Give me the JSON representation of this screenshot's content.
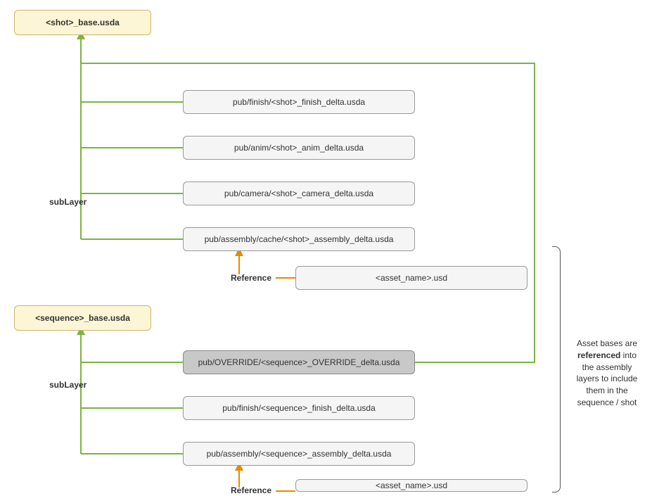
{
  "nodes": {
    "shot_base": "<shot>_base.usda",
    "sequence_base": "<sequence>_base.usda",
    "finish_shot": "pub/finish/<shot>_finish_delta.usda",
    "anim_shot": "pub/anim/<shot>_anim_delta.usda",
    "camera_shot": "pub/camera/<shot>_camera_delta.usda",
    "assembly_shot": "pub/assembly/cache/<shot>_assembly_delta.usda",
    "override_seq": "pub/OVERRIDE/<sequence>_OVERRIDE_delta.usda",
    "finish_seq": "pub/finish/<sequence>_finish_delta.usda",
    "assembly_seq": "pub/assembly/<sequence>_assembly_delta.usda",
    "asset1": "<asset_name>.usd",
    "asset2": "<asset_name>.usd"
  },
  "labels": {
    "sublayer1": "subLayer",
    "sublayer2": "subLayer",
    "reference1": "Reference",
    "reference2": "Reference"
  },
  "note": {
    "line1": "Asset bases are",
    "strong": "referenced",
    "line2": " into",
    "line3": "the assembly",
    "line4": "layers to include",
    "line5": "them in the",
    "line6": "sequence / shot"
  },
  "colors": {
    "green": "#7cb342",
    "orange": "#e68a00"
  }
}
